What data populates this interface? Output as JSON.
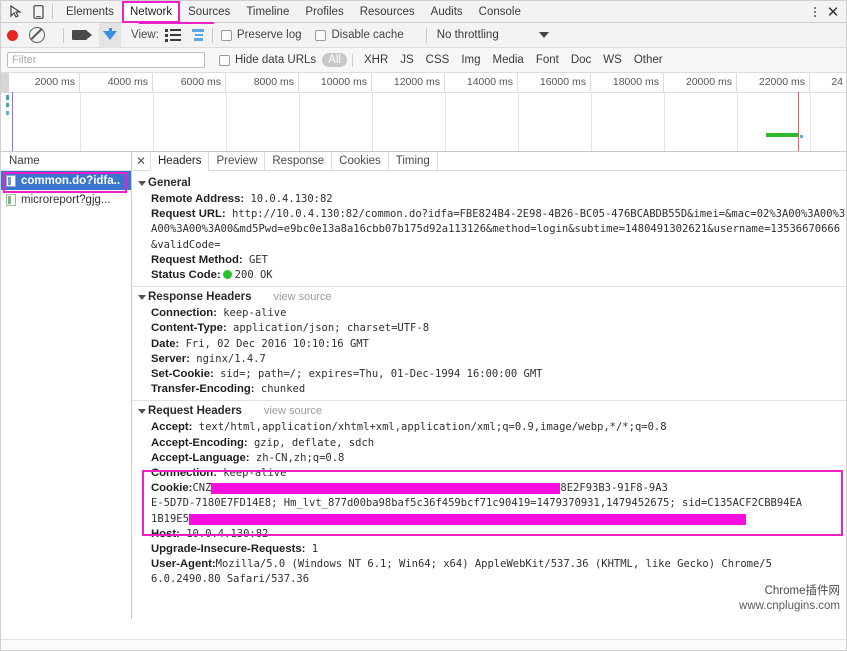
{
  "window": {
    "tabs": [
      {
        "label": "Elements",
        "selected": false
      },
      {
        "label": "Network",
        "selected": true
      },
      {
        "label": "Sources",
        "selected": false
      },
      {
        "label": "Timeline",
        "selected": false
      },
      {
        "label": "Profiles",
        "selected": false
      },
      {
        "label": "Resources",
        "selected": false
      },
      {
        "label": "Audits",
        "selected": false
      },
      {
        "label": "Console",
        "selected": false
      }
    ],
    "inspect_icon": "inspect-element-icon",
    "device_icon": "device-toolbar-icon",
    "menu_icon": "more-options-icon",
    "close_icon": "close-icon",
    "close_label": "✕",
    "highlight_color": "#f01fc6"
  },
  "toolbar": {
    "record_label": "record-button",
    "clear_label": "clear-button",
    "capture_screenshots_label": "capture-screenshots-button",
    "filter_toggle_label": "filter-button",
    "view_label": "View:",
    "view_list_label": "list-view-button",
    "view_waterfall_label": "waterfall-view-button",
    "preserve_log": "Preserve log",
    "disable_cache": "Disable cache",
    "throttling": "No throttling"
  },
  "filterbar": {
    "placeholder": "Filter",
    "value": "",
    "hide_data_urls": "Hide data URLs",
    "types": [
      "All",
      "XHR",
      "JS",
      "CSS",
      "Img",
      "Media",
      "Font",
      "Doc",
      "WS",
      "Other"
    ],
    "active_type": "All"
  },
  "overview": {
    "ticks": [
      "2000 ms",
      "4000 ms",
      "6000 ms",
      "8000 ms",
      "10000 ms",
      "12000 ms",
      "14000 ms",
      "16000 ms",
      "18000 ms",
      "20000 ms",
      "22000 ms",
      "24"
    ],
    "dom_content_loaded_color": "#a06ad0",
    "load_event_color": "#e35d5d",
    "bar_color": "#2db82d"
  },
  "sidebar": {
    "header": "Name",
    "requests": [
      {
        "name": "common.do?idfa..",
        "selected": true,
        "icon": "document-icon"
      },
      {
        "name": "microreport?gjg...",
        "selected": false,
        "icon": "document-icon"
      }
    ]
  },
  "detail": {
    "close_label": "✕",
    "tabs": [
      {
        "label": "Headers",
        "selected": true
      },
      {
        "label": "Preview",
        "selected": false
      },
      {
        "label": "Response",
        "selected": false
      },
      {
        "label": "Cookies",
        "selected": false
      },
      {
        "label": "Timing",
        "selected": false
      }
    ],
    "general": {
      "title": "General",
      "remote_address_key": "Remote Address:",
      "remote_address_value": "10.0.4.130:82",
      "request_url_key": "Request URL:",
      "request_url_value": "http://10.0.4.130:82/common.do?idfa=FBE824B4-2E98-4B26-BC05-476BCABDB55D&imei=&mac=02%3A00%3A00%3A00%3A00%3A00&md5Pwd=e9bc0e13a8a16cbb07b175d92a113126&method=login&subtime=1480491302621&username=13536670666&validCode=",
      "request_method_key": "Request Method:",
      "request_method_value": "GET",
      "status_code_key": "Status Code:",
      "status_code_value": "200 OK",
      "status_color": "#27c427"
    },
    "response_headers": {
      "title": "Response Headers",
      "view_source": "view source",
      "rows": [
        {
          "key": "Connection:",
          "value": "keep-alive"
        },
        {
          "key": "Content-Type:",
          "value": "application/json; charset=UTF-8"
        },
        {
          "key": "Date:",
          "value": "Fri, 02 Dec 2016 10:10:16 GMT"
        },
        {
          "key": "Server:",
          "value": "nginx/1.4.7"
        },
        {
          "key": "Set-Cookie:",
          "value": "sid=; path=/; expires=Thu, 01-Dec-1994 16:00:00 GMT"
        },
        {
          "key": "Transfer-Encoding:",
          "value": "chunked"
        }
      ]
    },
    "request_headers": {
      "title": "Request Headers",
      "view_source": "view source",
      "rows": [
        {
          "key": "Accept:",
          "value": "text/html,application/xhtml+xml,application/xml;q=0.9,image/webp,*/*;q=0.8"
        },
        {
          "key": "Accept-Encoding:",
          "value": "gzip, deflate, sdch"
        },
        {
          "key": "Accept-Language:",
          "value": "zh-CN,zh;q=0.8"
        },
        {
          "key": "Connection:",
          "value": "keep-alive"
        }
      ],
      "cookie_key": "Cookie:",
      "cookie_prefix": "CNZ",
      "cookie_mid1": "8E2F93B3-91F8-9A3",
      "cookie_line2": "E-5D7D-7180E7FD14E8; Hm_lvt_877d00ba98baf5c36f459bcf71c90419=1479370931,1479452675; sid=C135ACF2CBB94EA",
      "cookie_line3": "1B19E5",
      "host_key": "Host:",
      "host_value": "10.0.4.130:82",
      "upgrade_key": "Upgrade-Insecure-Requests:",
      "upgrade_value": "1",
      "ua_key": "User-Agent:",
      "ua_value": "Mozilla/5.0 (Windows NT 6.1; Win64; x64) AppleWebKit/537.36 (KHTML, like Gecko) Chrome/5",
      "ua_value2": "6.0.2490.80 Safari/537.36"
    }
  },
  "watermark": {
    "line1": "Chrome插件网",
    "line2": "www.cnplugins.com"
  }
}
